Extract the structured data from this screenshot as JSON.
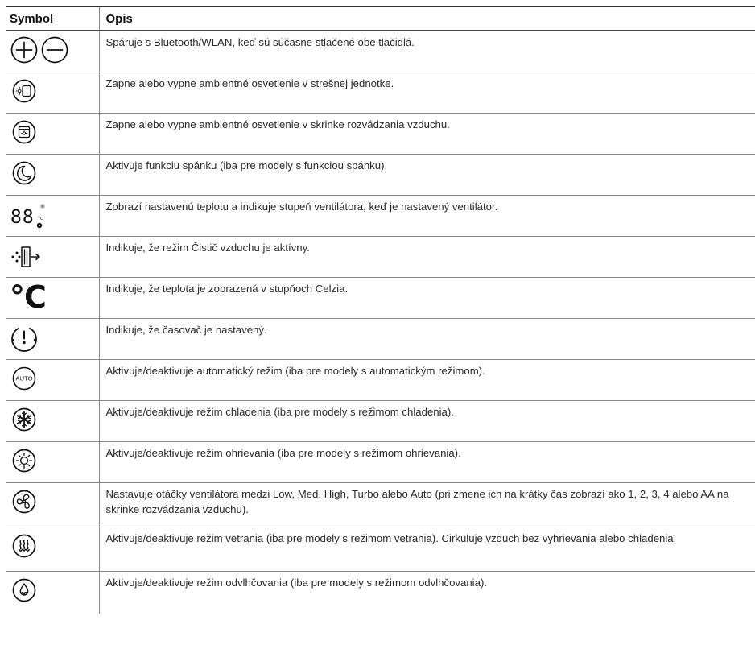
{
  "table": {
    "headers": {
      "symbol": "Symbol",
      "description": "Opis"
    },
    "rows": [
      {
        "icon": "plus-minus-icons",
        "description": "Spáruje s Bluetooth/WLAN, keď sú súčasne stlačené obe tlačidlá."
      },
      {
        "icon": "roof-light-icon",
        "description": "Zapne alebo vypne ambientné osvetlenie v strešnej jednotke."
      },
      {
        "icon": "cabinet-light-icon",
        "description": "Zapne alebo vypne ambientné osvetlenie v skrinke rozvádzania vzduchu."
      },
      {
        "icon": "moon-icon",
        "description": "Aktivuje funkciu spánku (iba pre modely s funkciou spánku)."
      },
      {
        "icon": "display-icon",
        "display_digits": "88",
        "display_unit": "°c",
        "description": "Zobrazí nastavenú teplotu a indikuje stupeň ventilátora, keď je nastavený ventilátor."
      },
      {
        "icon": "air-purifier-icon",
        "description": "Indikuje, že režim Čistič vzduchu je aktívny."
      },
      {
        "icon": "celsius-icon",
        "celsius_text": "°C",
        "description": "Indikuje, že teplota je zobrazená v stupňoch Celzia."
      },
      {
        "icon": "timer-icon",
        "description": "Indikuje, že časovač je nastavený."
      },
      {
        "icon": "auto-mode-icon",
        "auto_text": "AUTO",
        "description": "Aktivuje/deaktivuje automatický režim (iba pre modely s automatickým režimom)."
      },
      {
        "icon": "snowflake-icon",
        "description": "Aktivuje/deaktivuje režim chladenia (iba pre modely s režimom chladenia)."
      },
      {
        "icon": "sun-icon",
        "description": "Aktivuje/deaktivuje režim ohrievania (iba pre modely s režimom ohrievania)."
      },
      {
        "icon": "fan-icon",
        "description": "Nastavuje otáčky ventilátora medzi Low, Med, High, Turbo alebo Auto (pri zmene ich na krátky čas zobrazí ako 1, 2, 3, 4 alebo AA na skrinke rozvádzania vzduchu)."
      },
      {
        "icon": "ventilation-icon",
        "description": "Aktivuje/deaktivuje režim vetrania (iba pre modely s režimom vetrania). Cirkuluje vzduch bez vyhrievania alebo chladenia."
      },
      {
        "icon": "dehumidify-icon",
        "description": "Aktivuje/deaktivuje režim odvlhčovania (iba pre modely s režimom odvlhčovania)."
      }
    ]
  }
}
